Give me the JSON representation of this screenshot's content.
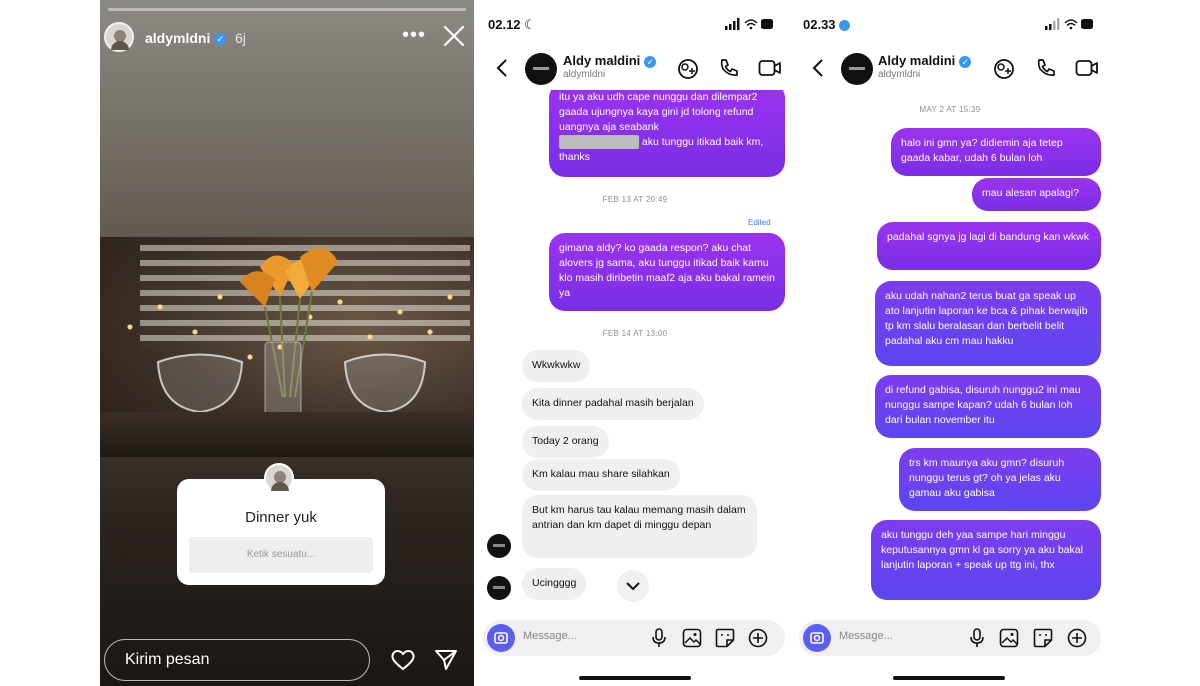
{
  "story": {
    "username": "aldymldni",
    "time": "6j",
    "card_title": "Dinner yuk",
    "card_placeholder": "Ketik sesuatu...",
    "reply_placeholder": "Kirim pesan",
    "icons": [
      "more-icon",
      "close-icon",
      "heart-icon",
      "send-icon"
    ]
  },
  "chat1": {
    "status_time": "02.12",
    "contact_name": "Aldy maldini",
    "contact_handle": "aldymldni",
    "out_msg_1": "itu ya aku udh cape nunggu dan dilempar2 gaada ujungnya kaya gini jd tolong refund uangnya aja seabank",
    "out_msg_1_tail": "aku tunggu itikad baik km, thanks",
    "stamp_1": "FEB 13 AT 20:49",
    "edited_label": "Edited",
    "out_msg_2": "gimana aldy? ko gaada respon? aku chat alovers jg sama, aku tunggu itikad baik kamu klo masih diribetin maaf2 aja aku bakal ramein ya",
    "stamp_2": "FEB 14 AT 13:00",
    "in_msgs": [
      "Wkwkwkw",
      "Kita dinner padahal masih berjalan",
      "Today 2 orang",
      "Km kalau mau share silahkan",
      "But km harus tau kalau memang masih dalam antrian dan km dapet di minggu depan",
      "Ucingggg"
    ],
    "composer_placeholder": "Message..."
  },
  "chat2": {
    "status_time": "02.33",
    "contact_name": "Aldy maldini",
    "contact_handle": "aldymldni",
    "stamp": "MAY 2 AT 15:39",
    "out_msgs": [
      "halo ini gmn ya? didiemin aja tetep gaada kabar, udah 6 bulan loh",
      "mau alesan apalagi?",
      "padahal sgnya jg lagi di bandung kan wkwk",
      "aku udah nahan2 terus buat ga speak up ato lanjutin laporan ke bca & pihak berwajib tp km slalu beralasan dan berbelit belit padahal aku cm mau hakku",
      "di refund gabisa, disuruh nunggu2 ini mau nunggu sampe kapan? udah 6 bulan loh dari bulan november itu",
      "trs km maunya aku gmn? disuruh nunggu terus gt? oh ya jelas aku gamau aku gabisa",
      "aku tunggu deh yaa sampe hari minggu keputusannya gmn kl ga sorry ya aku bakal lanjutin laporan + speak up ttg ini, thx"
    ],
    "composer_placeholder": "Message..."
  },
  "colors": {
    "outgoing_top": "#9b33f0",
    "outgoing_bottom": "#5c46ee",
    "incoming": "#efeff1",
    "verified": "#3897f0"
  }
}
